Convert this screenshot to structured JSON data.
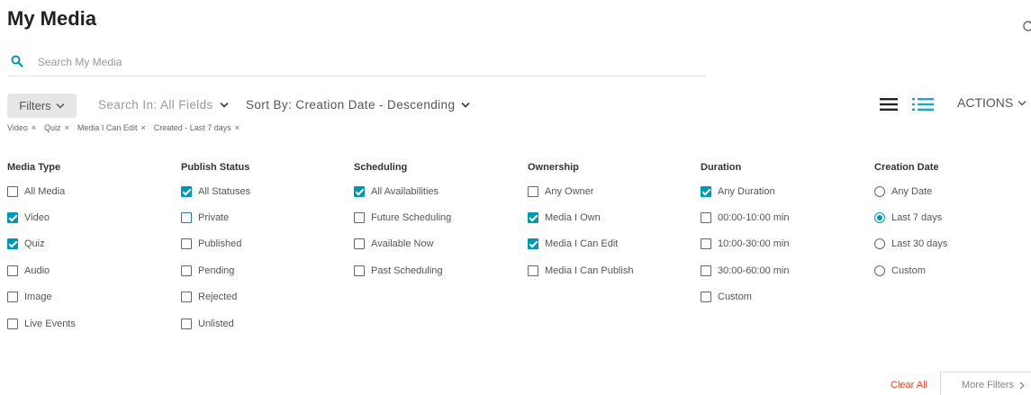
{
  "page": {
    "title": "My Media"
  },
  "search": {
    "placeholder": "Search My Media",
    "icon": "search-icon"
  },
  "toolbar": {
    "filters_label": "Filters",
    "search_in_label": "Search In: All Fields",
    "sort_by_label": "Sort By: Creation Date - Descending",
    "actions_label": "ACTIONS"
  },
  "active_filters": [
    {
      "label": "Video"
    },
    {
      "label": "Quiz"
    },
    {
      "label": "Media I Can Edit"
    },
    {
      "label": "Created - Last 7 days"
    }
  ],
  "filter_columns": [
    {
      "title": "Media Type",
      "input": "checkbox",
      "options": [
        {
          "label": "All Media",
          "checked": false
        },
        {
          "label": "Video",
          "checked": true
        },
        {
          "label": "Quiz",
          "checked": true
        },
        {
          "label": "Audio",
          "checked": false
        },
        {
          "label": "Image",
          "checked": false
        },
        {
          "label": "Live Events",
          "checked": false
        }
      ]
    },
    {
      "title": "Publish Status",
      "input": "checkbox",
      "options": [
        {
          "label": "All Statuses",
          "checked": true
        },
        {
          "label": "Private",
          "checked": false
        },
        {
          "label": "Published",
          "checked": false
        },
        {
          "label": "Pending",
          "checked": false
        },
        {
          "label": "Rejected",
          "checked": false
        },
        {
          "label": "Unlisted",
          "checked": false
        }
      ]
    },
    {
      "title": "Scheduling",
      "input": "checkbox",
      "options": [
        {
          "label": "All Availabilities",
          "checked": true
        },
        {
          "label": "Future Scheduling",
          "checked": false
        },
        {
          "label": "Available Now",
          "checked": false
        },
        {
          "label": "Past Scheduling",
          "checked": false
        }
      ]
    },
    {
      "title": "Ownership",
      "input": "checkbox",
      "options": [
        {
          "label": "Any Owner",
          "checked": false
        },
        {
          "label": "Media I Own",
          "checked": true
        },
        {
          "label": "Media I Can Edit",
          "checked": true
        },
        {
          "label": "Media I Can Publish",
          "checked": false
        }
      ]
    },
    {
      "title": "Duration",
      "input": "checkbox",
      "options": [
        {
          "label": "Any Duration",
          "checked": true
        },
        {
          "label": "00:00-10:00 min",
          "checked": false
        },
        {
          "label": "10:00-30:00 min",
          "checked": false
        },
        {
          "label": "30:00-60:00 min",
          "checked": false
        },
        {
          "label": "Custom",
          "checked": false
        }
      ]
    },
    {
      "title": "Creation Date",
      "input": "radio",
      "options": [
        {
          "label": "Any Date",
          "checked": false
        },
        {
          "label": "Last 7 days",
          "checked": true
        },
        {
          "label": "Last 30 days",
          "checked": false
        },
        {
          "label": "Custom",
          "checked": false
        }
      ]
    }
  ],
  "footer": {
    "clear_all_label": "Clear All",
    "more_filters_label": "More Filters"
  },
  "colors": {
    "accent": "#0097b5",
    "clear": "#d24a2c",
    "list_view_active": "#1aa7c8"
  }
}
